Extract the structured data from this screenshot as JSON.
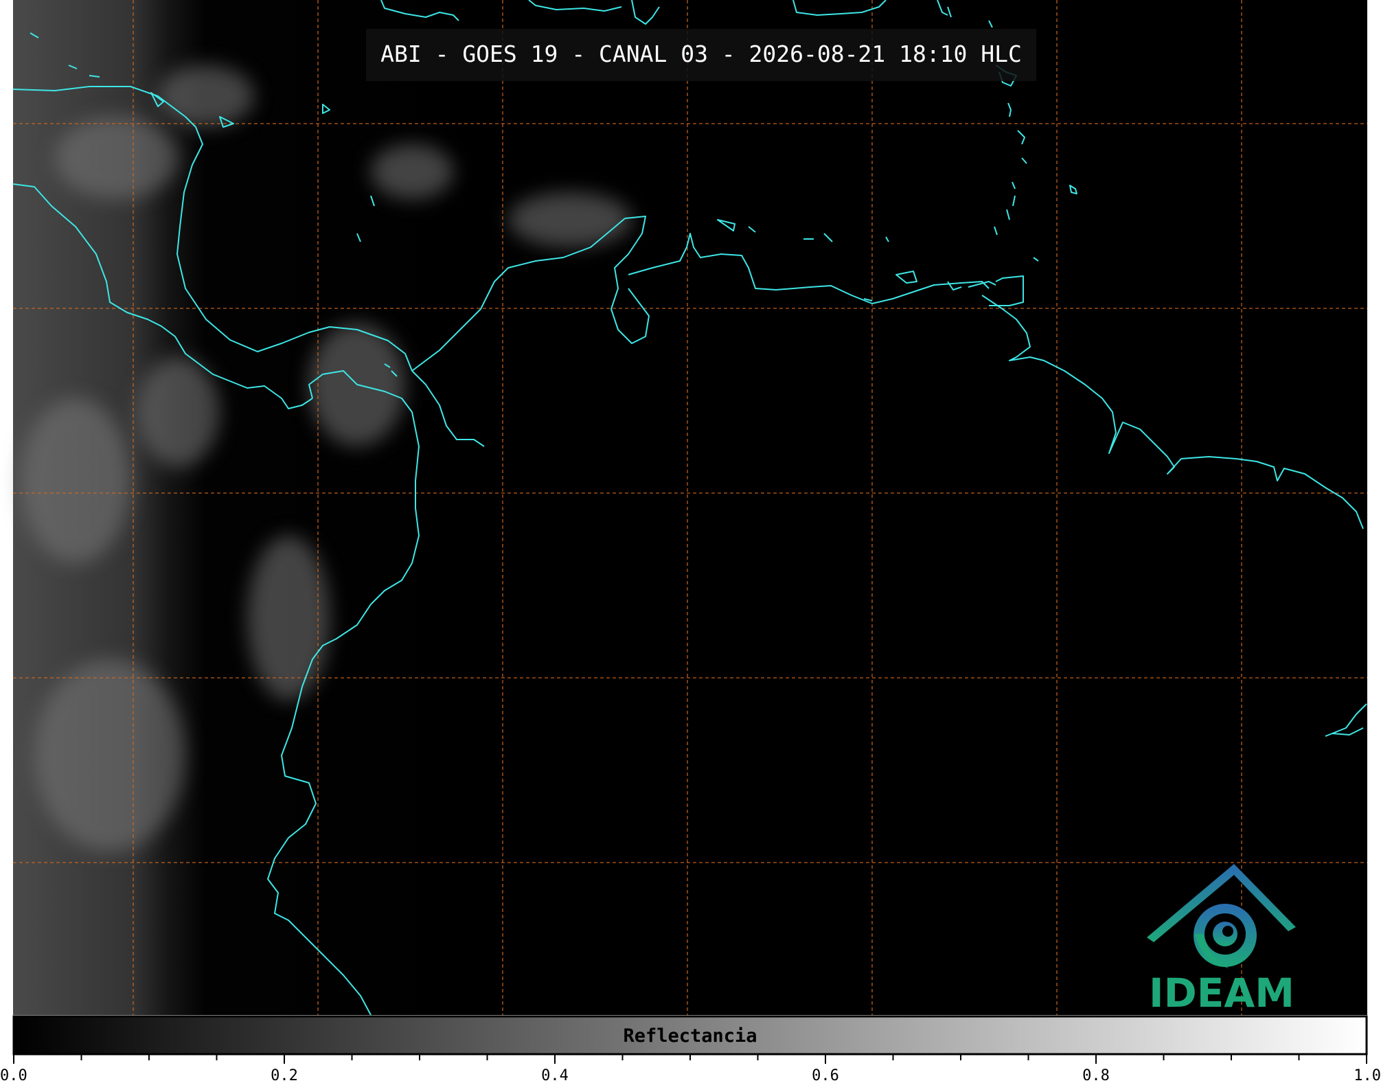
{
  "title": "ABI - GOES 19 - CANAL 03 - 2026-08-21 18:10 HLC",
  "colorbar": {
    "label": "Reflectancia",
    "min": 0.0,
    "max": 1.0,
    "ticks": [
      {
        "value": 0.0,
        "label": "0.0"
      },
      {
        "value": 0.2,
        "label": "0.2"
      },
      {
        "value": 0.4,
        "label": "0.4"
      },
      {
        "value": 0.6,
        "label": "0.6"
      },
      {
        "value": 0.8,
        "label": "0.8"
      },
      {
        "value": 1.0,
        "label": "1.0"
      }
    ],
    "minor_step": 0.05,
    "gradient": [
      "#000000",
      "#ffffff"
    ]
  },
  "logo": {
    "text": "IDEAM",
    "colors": [
      "#2a6db0",
      "#1ea87a"
    ]
  },
  "colors": {
    "background": "#000000",
    "coastline": "#3ee6e6",
    "graticule": "#d2691e"
  }
}
